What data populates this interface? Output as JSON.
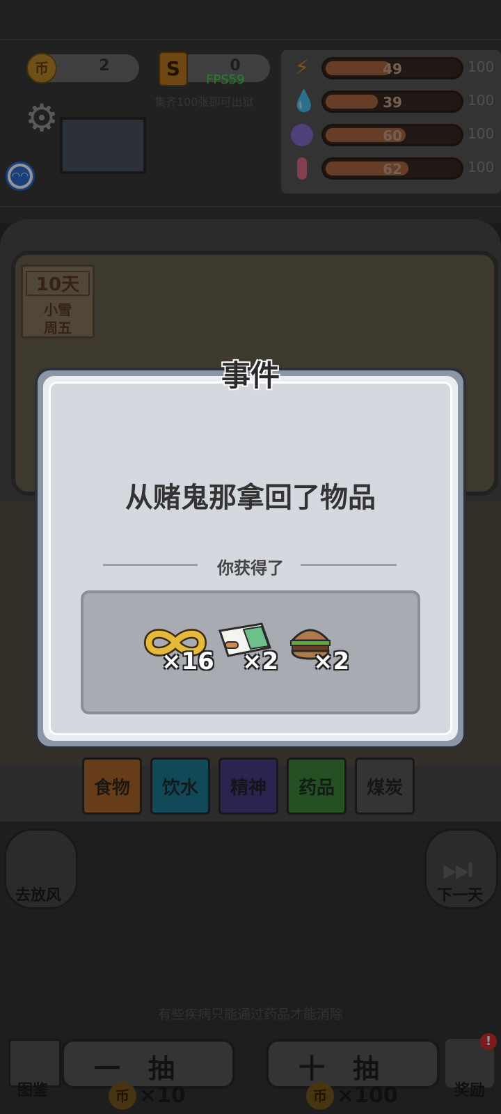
{
  "hud": {
    "coin_symbol": "币",
    "coins": "2",
    "s_symbol": "S",
    "s_value": "0",
    "fps": "FPS59",
    "collect_hint": "集齐100张即可出狱"
  },
  "stats": [
    {
      "name": "energy",
      "icon": "lightning-icon",
      "value": "49",
      "max": "100",
      "level": 0.49,
      "color": "#d88b2b"
    },
    {
      "name": "water",
      "icon": "water-drop-icon",
      "value": "39",
      "max": "100",
      "level": 0.39,
      "color": "#5fb0e0"
    },
    {
      "name": "mind",
      "icon": "brain-icon",
      "value": "60",
      "max": "100",
      "level": 0.6,
      "color": "#8a6fd0"
    },
    {
      "name": "temperature",
      "icon": "thermometer-icon",
      "value": "62",
      "max": "100",
      "level": 0.62,
      "color": "#e06d8a"
    }
  ],
  "day_board": {
    "days": "10天",
    "weather": "小雪",
    "weekday": "周五"
  },
  "categories": [
    {
      "label": "食物",
      "color": "#b06a2a"
    },
    {
      "label": "饮水",
      "color": "#1f7f9a"
    },
    {
      "label": "精神",
      "color": "#4a3f8a"
    },
    {
      "label": "药品",
      "color": "#3f8a3f"
    },
    {
      "label": "煤炭",
      "color": "#5a5a5a"
    }
  ],
  "actions": {
    "go_out": "去放风",
    "next_day": "下一天",
    "tip": "有些疾病只能通过药品才能消除",
    "draw_one": "一抽",
    "draw_ten": "十抽",
    "cost_one": "×10",
    "cost_ten": "×100",
    "book": "图鉴",
    "reward": "奖励",
    "badge": "!"
  },
  "modal": {
    "title": "事件",
    "message": "从赌鬼那拿回了物品",
    "gain_label": "你获得了",
    "items": [
      {
        "icon": "infinity-ribbon-icon",
        "count": "×16"
      },
      {
        "icon": "medicine-box-icon",
        "count": "×2"
      },
      {
        "icon": "burger-icon",
        "count": "×2"
      }
    ]
  }
}
